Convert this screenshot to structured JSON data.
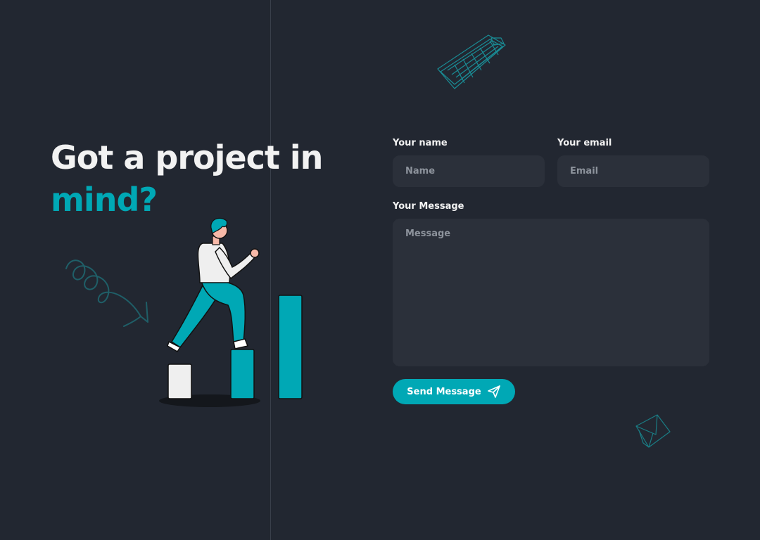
{
  "hero": {
    "title_line1": "Got a project in",
    "title_line2": "mind?"
  },
  "form": {
    "name": {
      "label": "Your name",
      "placeholder": "Name",
      "value": ""
    },
    "email": {
      "label": "Your email",
      "placeholder": "Email",
      "value": ""
    },
    "message": {
      "label": "Your Message",
      "placeholder": "Message",
      "value": ""
    },
    "submit_label": "Send Message",
    "submit_icon": "paper-plane-icon"
  },
  "decorations": {
    "top_icon": "keyboard-sketch-icon",
    "bottom_icon": "envelope-sketch-icon",
    "illustration": "person-climbing-bar-chart-illustration"
  },
  "colors": {
    "background": "#222731",
    "accent": "#00a8b5",
    "input_background": "#2b303a",
    "text": "#f2f2f2",
    "placeholder": "#8d939c"
  }
}
